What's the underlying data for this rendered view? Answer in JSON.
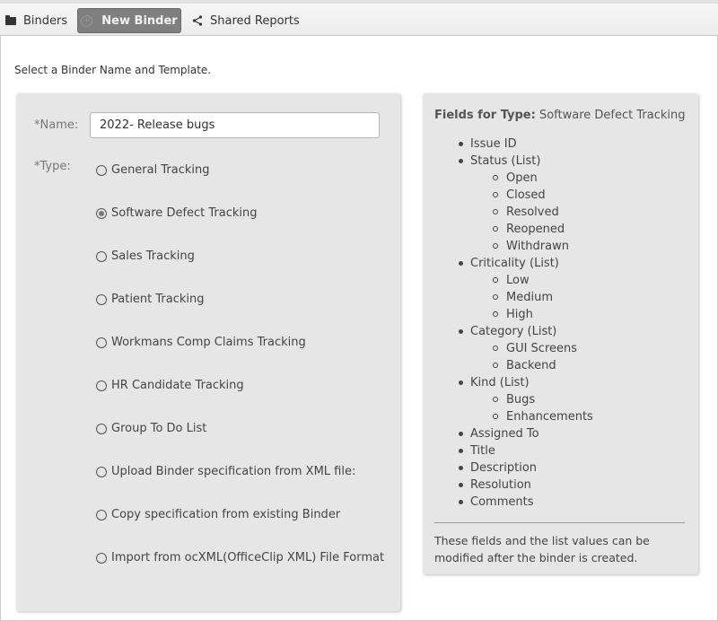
{
  "nav": {
    "binders_label": "Binders",
    "new_binder_label": "New Binder",
    "shared_reports_label": "Shared Reports"
  },
  "instruction": "Select a Binder Name and Template.",
  "form": {
    "name_label": "*Name:",
    "name_value": "2022- Release bugs",
    "type_label": "*Type:",
    "type_options": [
      {
        "label": "General Tracking",
        "selected": false
      },
      {
        "label": "Software Defect Tracking",
        "selected": true
      },
      {
        "label": "Sales Tracking",
        "selected": false
      },
      {
        "label": "Patient Tracking",
        "selected": false
      },
      {
        "label": "Workmans Comp Claims Tracking",
        "selected": false
      },
      {
        "label": "HR Candidate Tracking",
        "selected": false
      },
      {
        "label": "Group To Do List",
        "selected": false
      },
      {
        "label": "Upload Binder specification from XML file:",
        "selected": false
      },
      {
        "label": "Copy specification from existing Binder",
        "selected": false
      },
      {
        "label": "Import from ocXML(OfficeClip XML) File Format",
        "selected": false
      }
    ]
  },
  "fields_panel": {
    "title_prefix": "Fields for Type:",
    "title_type": "Software Defect Tracking",
    "fields": [
      {
        "label": "Issue ID",
        "level": 1
      },
      {
        "label": "Status (List)",
        "level": 1
      },
      {
        "label": "Open",
        "level": 2
      },
      {
        "label": "Closed",
        "level": 2
      },
      {
        "label": "Resolved",
        "level": 2
      },
      {
        "label": "Reopened",
        "level": 2
      },
      {
        "label": "Withdrawn",
        "level": 2
      },
      {
        "label": "Criticality (List)",
        "level": 1
      },
      {
        "label": "Low",
        "level": 2
      },
      {
        "label": "Medium",
        "level": 2
      },
      {
        "label": "High",
        "level": 2
      },
      {
        "label": "Category (List)",
        "level": 1
      },
      {
        "label": "GUI Screens",
        "level": 2
      },
      {
        "label": "Backend",
        "level": 2
      },
      {
        "label": "Kind (List)",
        "level": 1
      },
      {
        "label": "Bugs",
        "level": 2
      },
      {
        "label": "Enhancements",
        "level": 2
      },
      {
        "label": "Assigned To",
        "level": 1
      },
      {
        "label": "Title",
        "level": 1
      },
      {
        "label": "Description",
        "level": 1
      },
      {
        "label": "Resolution",
        "level": 1
      },
      {
        "label": "Comments",
        "level": 1
      }
    ],
    "footnote": "These fields and the list values can be modified after the binder is created."
  }
}
